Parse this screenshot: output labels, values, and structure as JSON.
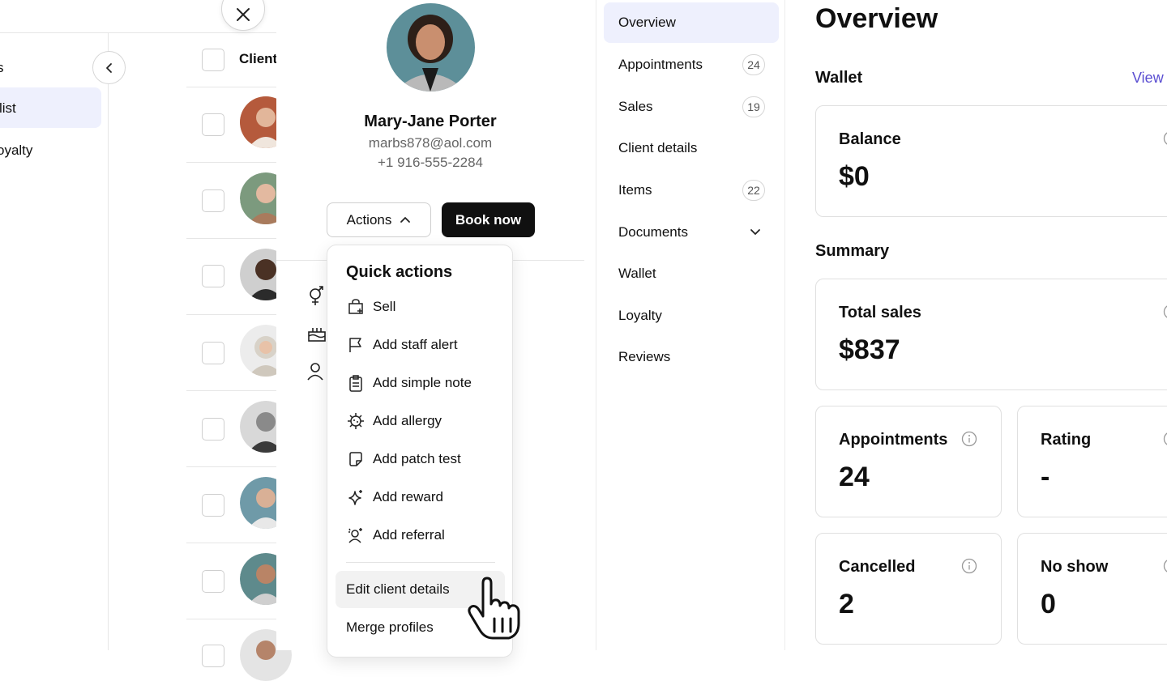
{
  "left_nav": {
    "item_partial_top": "s",
    "item_active": "list",
    "item_loyalty": "oyalty"
  },
  "client_table": {
    "column_header": "Client"
  },
  "profile": {
    "name": "Mary-Jane Porter",
    "email": "marbs878@aol.com",
    "phone": "+1 916-555-2284",
    "actions_label": "Actions",
    "book_label": "Book now"
  },
  "quick_actions": {
    "title": "Quick actions",
    "items": [
      {
        "label": "Sell",
        "icon": "bag-plus-icon"
      },
      {
        "label": "Add staff alert",
        "icon": "flag-icon"
      },
      {
        "label": "Add simple note",
        "icon": "clipboard-icon"
      },
      {
        "label": "Add allergy",
        "icon": "virus-icon"
      },
      {
        "label": "Add patch test",
        "icon": "sticky-note-icon"
      },
      {
        "label": "Add reward",
        "icon": "sparkle-icon"
      },
      {
        "label": "Add referral",
        "icon": "user-sparkle-icon"
      }
    ],
    "edit_label": "Edit client details",
    "merge_label": "Merge profiles"
  },
  "section_nav": {
    "items": [
      {
        "label": "Overview",
        "badge": ""
      },
      {
        "label": "Appointments",
        "badge": "24"
      },
      {
        "label": "Sales",
        "badge": "19"
      },
      {
        "label": "Client details",
        "badge": ""
      },
      {
        "label": "Items",
        "badge": "22"
      },
      {
        "label": "Documents",
        "badge": ""
      },
      {
        "label": "Wallet",
        "badge": ""
      },
      {
        "label": "Loyalty",
        "badge": ""
      },
      {
        "label": "Reviews",
        "badge": ""
      }
    ]
  },
  "overview": {
    "title": "Overview",
    "wallet_heading": "Wallet",
    "view_link": "View w",
    "balance_label": "Balance",
    "balance_value": "$0",
    "summary_heading": "Summary",
    "total_sales_label": "Total sales",
    "total_sales_value": "$837",
    "appointments_label": "Appointments",
    "appointments_value": "24",
    "rating_label": "Rating",
    "rating_value": "-",
    "cancelled_label": "Cancelled",
    "cancelled_value": "2",
    "noshow_label": "No show",
    "noshow_value": "0"
  },
  "colors": {
    "accent": "#5a4ed1",
    "active_bg": "#eef0fd",
    "primary_button": "#101010"
  }
}
